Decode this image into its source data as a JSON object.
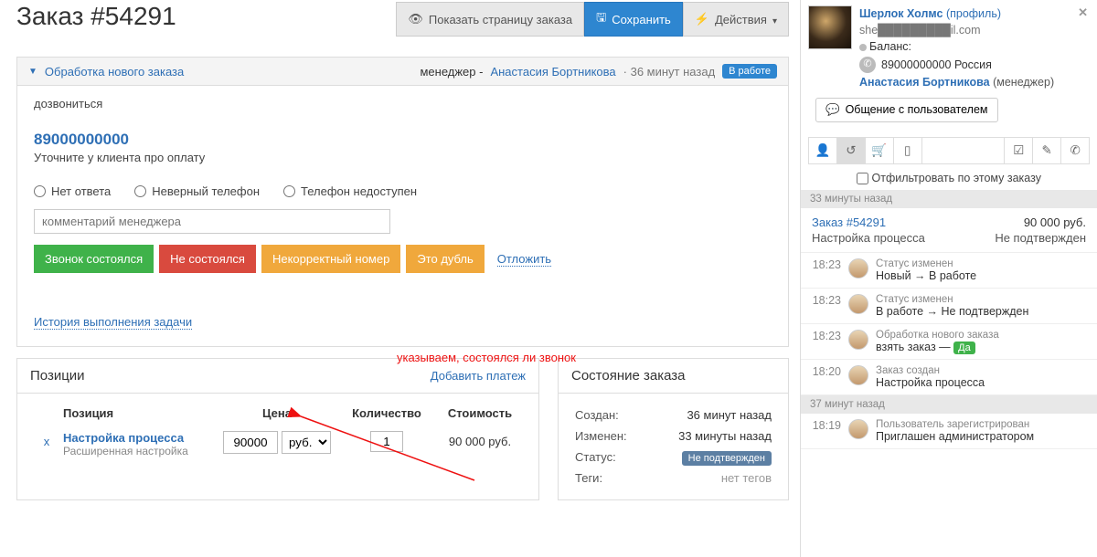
{
  "header": {
    "title": "Заказ #54291",
    "show_page": "Показать страницу заказа",
    "save": "Сохранить",
    "actions": "Действия"
  },
  "panel": {
    "title": "Обработка нового заказа",
    "manager_label": "менеджер - ",
    "manager_name": "Анастасия Бортникова",
    "ago": "36 минут назад",
    "status_badge": "В работе",
    "task": "дозвониться",
    "phone": "89000000000",
    "clarify": "Уточните у клиента про оплату",
    "radios": {
      "no_answer": "Нет ответа",
      "wrong_phone": "Неверный телефон",
      "unavailable": "Телефон недоступен"
    },
    "comment_placeholder": "комментарий менеджера",
    "buttons": {
      "done": "Звонок состоялся",
      "not_done": "Не состоялся",
      "bad_number": "Некорректный номер",
      "dup": "Это дубль"
    },
    "postpone": "Отложить",
    "history": "История выполнения задачи"
  },
  "annotation": "указываем, состоялся ли звонок",
  "positions": {
    "title": "Позиции",
    "add_payment": "Добавить платеж",
    "cols": {
      "position": "Позиция",
      "price": "Цена",
      "qty": "Количество",
      "cost": "Стоимость"
    },
    "item": {
      "name": "Настройка процесса",
      "sub": "Расширенная настройка",
      "price": "90000",
      "currency": "руб.",
      "qty": "1",
      "cost": "90 000 руб."
    }
  },
  "order_state": {
    "title": "Состояние заказа",
    "rows": {
      "created_k": "Создан:",
      "created_v": "36 минут назад",
      "changed_k": "Изменен:",
      "changed_v": "33 минуты назад",
      "status_k": "Статус:",
      "status_v": "Не подтвержден",
      "tags_k": "Теги:",
      "tags_v": "нет тегов"
    }
  },
  "sidebar": {
    "user": {
      "name": "Шерлок Холмс",
      "profile": "(профиль)",
      "email": "she█████████il.com",
      "balance_label": "Баланс:",
      "phone": "89000000000 Россия",
      "manager": "Анастасия Бортникова",
      "manager_role": "(менеджер)"
    },
    "chat_btn": "Общение с пользователем",
    "filter_label": "Отфильтровать по этому заказу",
    "sep1": "33 минуты назад",
    "card": {
      "order": "Заказ #54291",
      "amount": "90 000 руб.",
      "name": "Настройка процесса",
      "state": "Не подтвержден"
    },
    "events": [
      {
        "time": "18:23",
        "label": "Статус изменен",
        "text": "Новый → В работе"
      },
      {
        "time": "18:23",
        "label": "Статус изменен",
        "text": "В работе → Не подтвержден"
      },
      {
        "time": "18:23",
        "label": "Обработка нового заказа",
        "text_pre": "взять заказ — ",
        "badge": "Да"
      },
      {
        "time": "18:20",
        "label": "Заказ создан",
        "text": "Настройка процесса"
      }
    ],
    "sep2": "37 минут назад",
    "events2": [
      {
        "time": "18:19",
        "label": "Пользователь зарегистрирован",
        "text": "Приглашен администратором"
      }
    ]
  }
}
